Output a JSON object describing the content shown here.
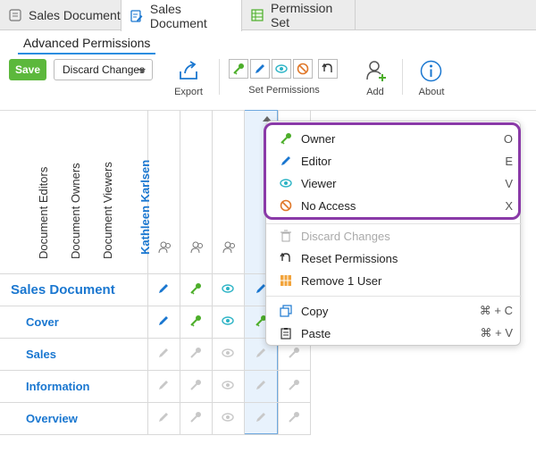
{
  "tabs": [
    {
      "label": "Sales Document",
      "icon": "list-icon"
    },
    {
      "label": "Sales Document",
      "icon": "edit-document-icon",
      "active": true
    },
    {
      "label": "Permission Set",
      "icon": "spreadsheet-icon"
    }
  ],
  "ribbon": {
    "tab_label": "Advanced Permissions",
    "save_label": "Save",
    "discard_label": "Discard Changes",
    "export_label": "Export",
    "set_permissions_label": "Set Permissions",
    "add_label": "Add",
    "about_label": "About"
  },
  "columns": [
    "Document Editors",
    "Document Owners",
    "Document Viewers",
    "Kathleen Karlsen"
  ],
  "rows": [
    "Sales Document",
    "Cover",
    "Sales",
    "Information",
    "Overview"
  ],
  "menu": {
    "items": [
      {
        "label": "Owner",
        "key": "O"
      },
      {
        "label": "Editor",
        "key": "E"
      },
      {
        "label": "Viewer",
        "key": "V"
      },
      {
        "label": "No Access",
        "key": "X"
      },
      {
        "label": "Discard Changes",
        "key": ""
      },
      {
        "label": "Reset Permissions",
        "key": ""
      },
      {
        "label": "Remove 1 User",
        "key": ""
      },
      {
        "label": "Copy",
        "key": "⌘ + C"
      },
      {
        "label": "Paste",
        "key": "⌘ + V"
      }
    ]
  },
  "colors": {
    "accent": "#1a77d0",
    "save_green": "#5cb83c",
    "owner_green": "#4cae2a",
    "highlight_purple": "#8a3aa8"
  }
}
